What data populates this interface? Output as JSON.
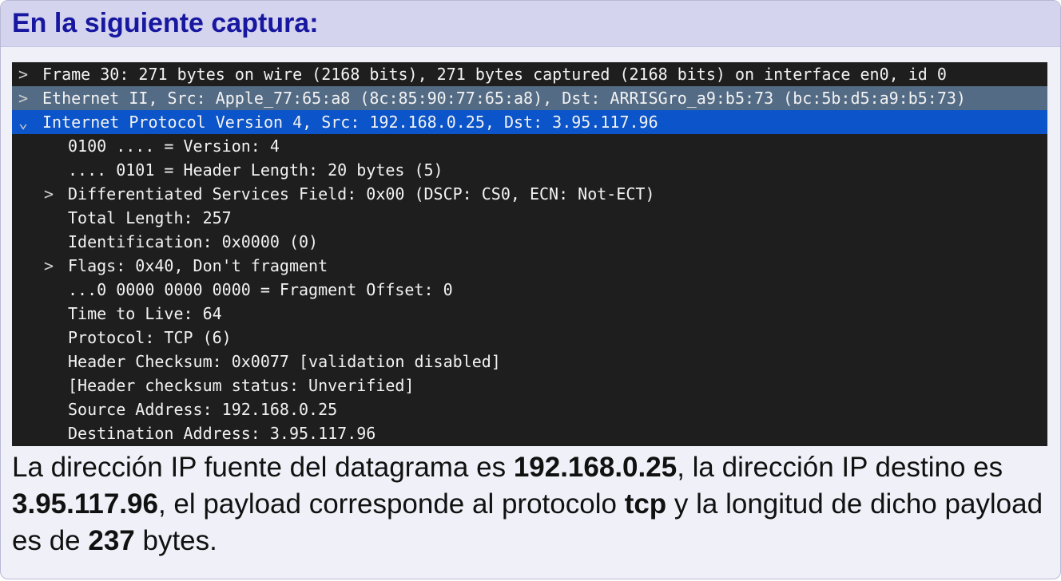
{
  "title": "En la siguiente captura:",
  "capture": {
    "rows": [
      {
        "toggle": ">",
        "text": "Frame 30: 271 bytes on wire (2168 bits), 271 bytes captured (2168 bits) on interface en0, id 0"
      },
      {
        "toggle": ">",
        "text": "Ethernet II, Src: Apple_77:65:a8 (8c:85:90:77:65:a8), Dst: ARRISGro_a9:b5:73 (bc:5b:d5:a9:b5:73)"
      },
      {
        "toggle": "⌄",
        "text": "Internet Protocol Version 4, Src: 192.168.0.25, Dst: 3.95.117.96"
      },
      {
        "toggle": "",
        "text": "0100 .... = Version: 4"
      },
      {
        "toggle": "",
        "text": ".... 0101 = Header Length: 20 bytes (5)"
      },
      {
        "toggle": ">",
        "text": "Differentiated Services Field: 0x00 (DSCP: CS0, ECN: Not-ECT)"
      },
      {
        "toggle": "",
        "text": "Total Length: 257"
      },
      {
        "toggle": "",
        "text": "Identification: 0x0000 (0)"
      },
      {
        "toggle": ">",
        "text": "Flags: 0x40, Don't fragment"
      },
      {
        "toggle": "",
        "text": "...0 0000 0000 0000 = Fragment Offset: 0"
      },
      {
        "toggle": "",
        "text": "Time to Live: 64"
      },
      {
        "toggle": "",
        "text": "Protocol: TCP (6)"
      },
      {
        "toggle": "",
        "text": "Header Checksum: 0x0077 [validation disabled]"
      },
      {
        "toggle": "",
        "text": "[Header checksum status: Unverified]"
      },
      {
        "toggle": "",
        "text": "Source Address: 192.168.0.25"
      },
      {
        "toggle": "",
        "text": "Destination Address: 3.95.117.96"
      }
    ]
  },
  "answer": {
    "part1": "La dirección IP fuente del datagrama es ",
    "src_ip": "192.168.0.25",
    "part2": ", la dirección IP destino es ",
    "dst_ip": "3.95.117.96",
    "part3": ", el payload corresponde al protocolo ",
    "protocol": "tcp",
    "part4": " y la longitud de dicho payload es de ",
    "payload_length": "237",
    "part5": " bytes."
  },
  "colors": {
    "title_text": "#1717a0",
    "title_bar": "#d4d4ee",
    "capture_bg": "#1e1e1e",
    "row_highlight_gray": "#536b85",
    "row_highlight_blue": "#0b54c9"
  }
}
